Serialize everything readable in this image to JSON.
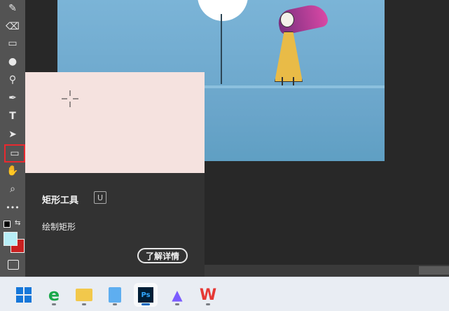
{
  "tooltip": {
    "title": "矩形工具",
    "shortcut": "U",
    "description": "绘制矩形",
    "more_label": "了解详情"
  },
  "tools": [
    {
      "name": "spot-healing-icon",
      "glyph": "✎"
    },
    {
      "name": "eraser-icon",
      "glyph": "⌫"
    },
    {
      "name": "gradient-icon",
      "glyph": "▭"
    },
    {
      "name": "blur-icon",
      "glyph": "💧"
    },
    {
      "name": "dodge-icon",
      "glyph": "⚲"
    },
    {
      "name": "pen-icon",
      "glyph": "✒"
    },
    {
      "name": "type-icon",
      "glyph": "T"
    },
    {
      "name": "path-selection-icon",
      "glyph": "➤"
    },
    {
      "name": "rectangle-tool-icon",
      "glyph": "▭"
    },
    {
      "name": "hand-icon",
      "glyph": "✋"
    },
    {
      "name": "zoom-icon",
      "glyph": "🔍"
    },
    {
      "name": "more-tools-icon",
      "glyph": "•••"
    }
  ],
  "colors": {
    "foreground": "#b8eef7",
    "background": "#c82020",
    "accent": "#e8292f"
  },
  "taskbar": {
    "apps": [
      "windows-start",
      "ie",
      "file-explorer",
      "notepad",
      "photoshop",
      "pictures",
      "wps"
    ]
  }
}
